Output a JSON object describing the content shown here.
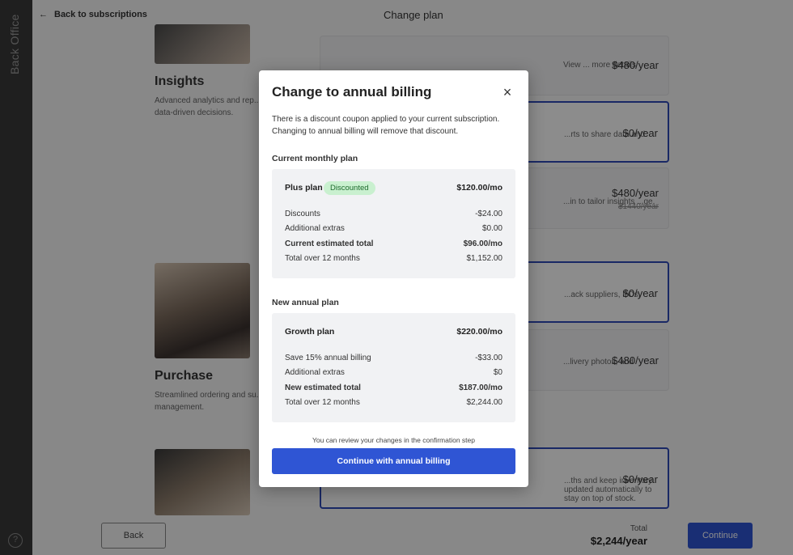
{
  "rail": {
    "brand": "Back Office",
    "help_glyph": "?"
  },
  "header": {
    "back_label": "Back to subscriptions",
    "back_arrow": "←",
    "title": "Change plan"
  },
  "products": [
    {
      "title": "Insights",
      "description": "Advanced analytics and rep... data-driven decisions."
    },
    {
      "title": "Purchase",
      "description": "Streamlined ordering and su... management."
    }
  ],
  "cards": [
    {
      "text": "View ... more details",
      "price": "$480/year"
    },
    {
      "text": "...rts to share data and",
      "price": "$0/year"
    },
    {
      "text": "...in to tailor insights ...ge.",
      "price": "$480/year",
      "strike": "$1440/year"
    },
    {
      "text": "...ack suppliers, POs.",
      "price": "$0/year"
    },
    {
      "text": "...livery photos, and",
      "price": "$480/year"
    },
    {
      "text": "...ths and keep inventory updated automatically to stay on top of stock.",
      "price": "$0/year"
    }
  ],
  "footer": {
    "back_label": "Back",
    "total_label": "Total",
    "total_value": "$2,244/year",
    "continue_label": "Continue"
  },
  "modal": {
    "title": "Change to annual billing",
    "close_glyph": "×",
    "intro": "There is a discount coupon applied to your current subscription. Changing to annual billing will remove that discount.",
    "current": {
      "heading": "Current monthly plan",
      "plan_name": "Plus plan",
      "badge": "Discounted",
      "plan_price": "$120.00/mo",
      "rows": [
        {
          "label": "Discounts",
          "value": "-$24.00"
        },
        {
          "label": "Additional extras",
          "value": "$0.00"
        },
        {
          "label": "Current estimated total",
          "value": "$96.00/mo"
        },
        {
          "label": "Total over 12 months",
          "value": "$1,152.00"
        }
      ]
    },
    "new": {
      "heading": "New annual plan",
      "plan_name": "Growth plan",
      "plan_price": "$220.00/mo",
      "rows": [
        {
          "label": "Save 15% annual billing",
          "value": "-$33.00"
        },
        {
          "label": "Additional extras",
          "value": "$0"
        },
        {
          "label": "New estimated total",
          "value": "$187.00/mo"
        },
        {
          "label": "Total over 12 months",
          "value": "$2,244.00"
        }
      ]
    },
    "hint": "You can review your changes in the confirmation step",
    "primary_label": "Continue with annual billing"
  },
  "colors": {
    "primary": "#2f55d4",
    "badge_bg": "#c9f0cf",
    "badge_text": "#1e6b2e",
    "selected_border": "#2f49b8"
  }
}
